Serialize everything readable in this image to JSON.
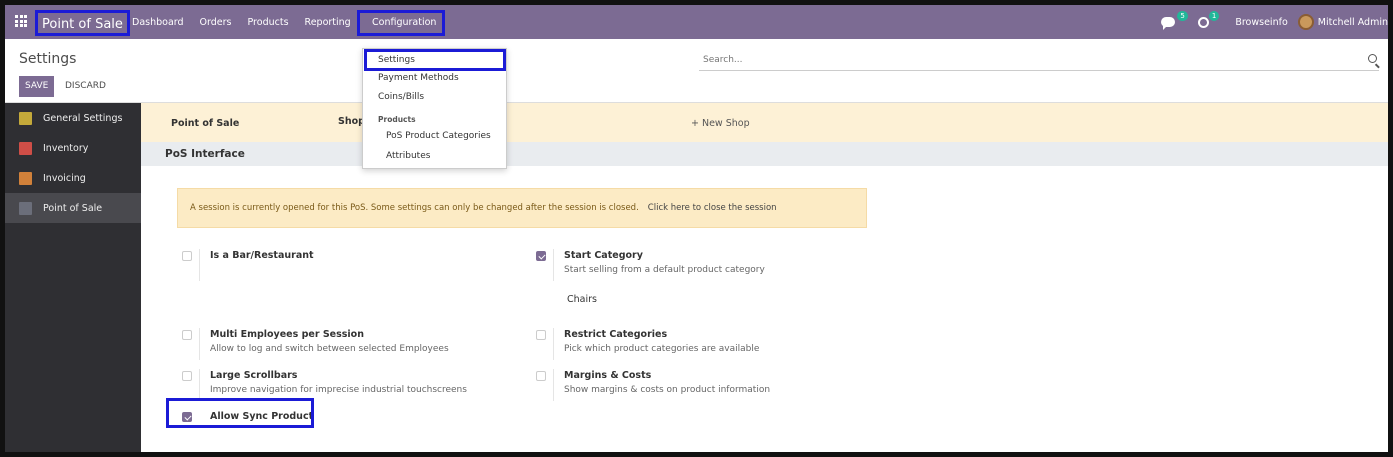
{
  "navbar": {
    "app_name": "Point of Sale",
    "menu": [
      "Dashboard",
      "Orders",
      "Products",
      "Reporting"
    ],
    "active_menu": "Configuration",
    "messages_count": "5",
    "activities_count": "1",
    "company": "Browseinfo",
    "user": "Mitchell Admin"
  },
  "control_panel": {
    "title": "Settings",
    "save_label": "SAVE",
    "discard_label": "DISCARD",
    "search_placeholder": "Search..."
  },
  "dropdown": {
    "settings": "Settings",
    "payment_methods": "Payment Methods",
    "coins_bills": "Coins/Bills",
    "products_header": "Products",
    "pos_product_categories": "PoS Product Categories",
    "attributes": "Attributes"
  },
  "sidebar": {
    "items": [
      {
        "label": "General Settings",
        "icon": "gear-icon"
      },
      {
        "label": "Inventory",
        "icon": "inventory-icon"
      },
      {
        "label": "Invoicing",
        "icon": "invoice-icon"
      },
      {
        "label": "Point of Sale",
        "icon": "pos-icon",
        "active": true
      }
    ]
  },
  "shopbar": {
    "pos_label": "Point of Sale",
    "shop_label": "Shop",
    "new_shop": "+ New Shop"
  },
  "section": {
    "title": "PoS Interface"
  },
  "alert": {
    "message": "A session is currently opened for this PoS. Some settings can only be changed after the session is closed.",
    "link": "Click here to close the session"
  },
  "settings": {
    "bar_restaurant": {
      "title": "Is a Bar/Restaurant",
      "checked": false
    },
    "start_category": {
      "title": "Start Category",
      "desc": "Start selling from a default product category",
      "value": "Chairs",
      "checked": true
    },
    "multi_employees": {
      "title": "Multi Employees per Session",
      "desc": "Allow to log and switch between selected Employees",
      "checked": false
    },
    "restrict_categories": {
      "title": "Restrict Categories",
      "desc": "Pick which product categories are available",
      "checked": false
    },
    "large_scrollbars": {
      "title": "Large Scrollbars",
      "desc": "Improve navigation for imprecise industrial touchscreens",
      "checked": false
    },
    "margins_costs": {
      "title": "Margins & Costs",
      "desc": "Show margins & costs on product information",
      "checked": false
    },
    "allow_sync_product": {
      "title": "Allow Sync Product",
      "checked": true
    }
  },
  "colors": {
    "primary": "#7c6b93",
    "highlight": "#1b1bd6",
    "sidebar_bg": "#2f2f33",
    "alert_bg": "#fcebc5"
  }
}
